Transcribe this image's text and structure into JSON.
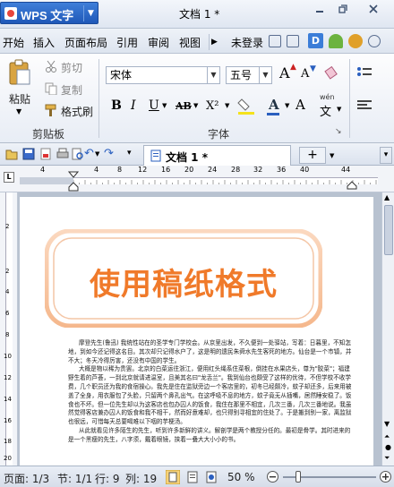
{
  "titlebar": {
    "app_name": "WPS 文字",
    "document_title": "文档 1 *"
  },
  "menu": {
    "tabs": [
      "开始",
      "插入",
      "页面布局",
      "引用",
      "审阅",
      "视图"
    ],
    "login": "未登录"
  },
  "ribbon": {
    "clipboard": {
      "paste": "粘贴",
      "cut": "剪切",
      "copy": "复制",
      "format_painter": "格式刷",
      "group": "剪贴板"
    },
    "font": {
      "name": "宋体",
      "size": "五号",
      "group": "字体",
      "grow": "A",
      "shrink": "A",
      "wen": "wén"
    }
  },
  "doc_tab": {
    "title": "文档 1 *"
  },
  "ruler": {
    "ticks": [
      "4",
      "4",
      "8",
      "12",
      "16",
      "20",
      "24",
      "28",
      "32",
      "36",
      "40",
      "44"
    ]
  },
  "vruler": {
    "ticks": [
      "2",
      "2",
      "4",
      "6",
      "8",
      "10",
      "12",
      "14",
      "16",
      "18",
      "20",
      "22"
    ]
  },
  "document": {
    "heading": "使用稿纸格式",
    "paragraphs": [
      "摩登先生(鲁迅) 我统性站在的圣学专门学校会。从京里出发，不久便到一处驿站，写着：日暮里，不知怎地，到如今还记得这名目。其次却只记得水户了，这是明的遗民朱舜水先生客死的地方。仙台是一个市镇，并不大；冬天冷得厉害，还没有中国的学生。",
      "大概是物以稀为贵罢。北京的白菜运往浙江，便用红头绳系住菜根，倒挂在水果店头，尊为\"胶菜\"；福建野生着的芦荟，一到北京就请进温室，且美其名曰\"龙舌兰\"。我到仙台也颇受了这样的优待，不但学校不收学费，几个职员还为我的食宿操心。我先是住在监狱旁边一个客店里的，初冬已经颇冷，蚊子却还多，后来用被盖了全身，用衣服包了头脸，只留两个鼻孔出气。在这呼吸不息的地方，蚊子竟无从插嘴，居然睡安稳了。饭食也不坏。但一位先生却以为这客店也包办囚人的饭食，我住在那里不相宜，几次三番，几次三番地说。我虽然觉得客店兼办囚人的饭食和我不相干，然而好意难却，也只得别寻相宜的住处了。于是搬到别一家，离监狱也很远，可惜每天总要喝难以下咽的芋梗汤。",
      "从此就看见许多陌生的先生，听到许多新鲜的讲义。解剖学是两个教授分任的。最初是骨学。其时进来的是一个黑瘦的先生，八字须，戴着眼镜，挟着一叠大大小小的书。"
    ]
  },
  "statusbar": {
    "page": "页面: 1/3",
    "section": "节: 1/1",
    "row": "行: 9",
    "col": "列: 19",
    "zoom": "50 %"
  }
}
